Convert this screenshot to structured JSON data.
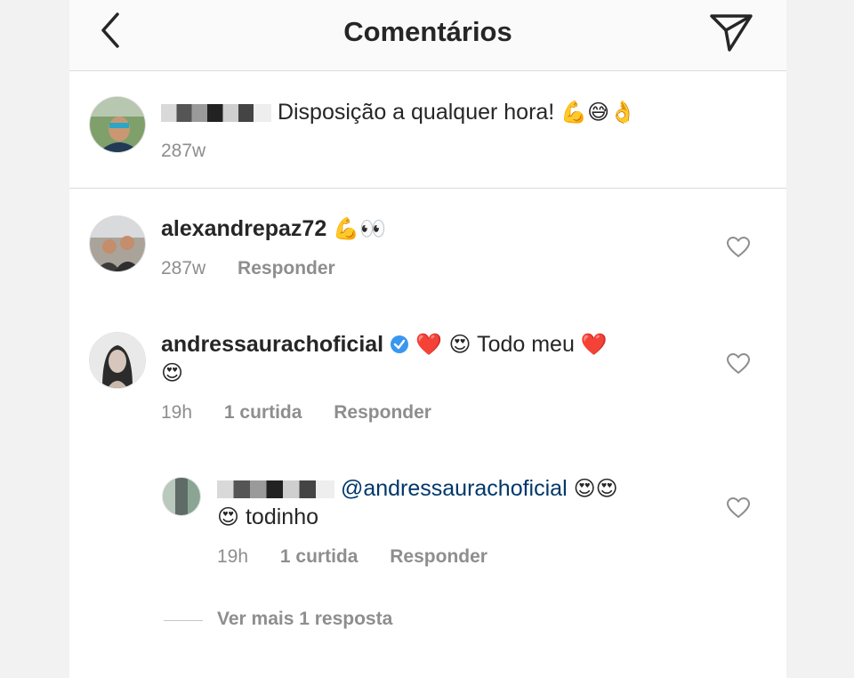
{
  "header": {
    "title": "Comentários"
  },
  "caption": {
    "text": "Disposição a qualquer hora!",
    "emojis": "💪😅👌",
    "time": "287w"
  },
  "comments": [
    {
      "username": "alexandrepaz72",
      "emojis": "💪👀",
      "time": "287w",
      "reply_label": "Responder"
    },
    {
      "username": "andressaurachoficial",
      "verified": true,
      "text_pre": "❤️ 😍",
      "text": "Todo meu",
      "text_post": "❤️",
      "text_line2": "😍",
      "time": "19h",
      "likes": "1 curtida",
      "reply_label": "Responder"
    }
  ],
  "reply": {
    "mention": "@andressaurachoficial",
    "emojis": "😍😍",
    "line2_emoji": "😍",
    "line2_text": "todinho",
    "time": "19h",
    "likes": "1 curtida",
    "reply_label": "Responder"
  },
  "view_more": "Ver mais 1 resposta",
  "colors": {
    "accent_verified": "#3897f0",
    "heart_outline": "#8e8e8e",
    "link": "#00376b"
  }
}
